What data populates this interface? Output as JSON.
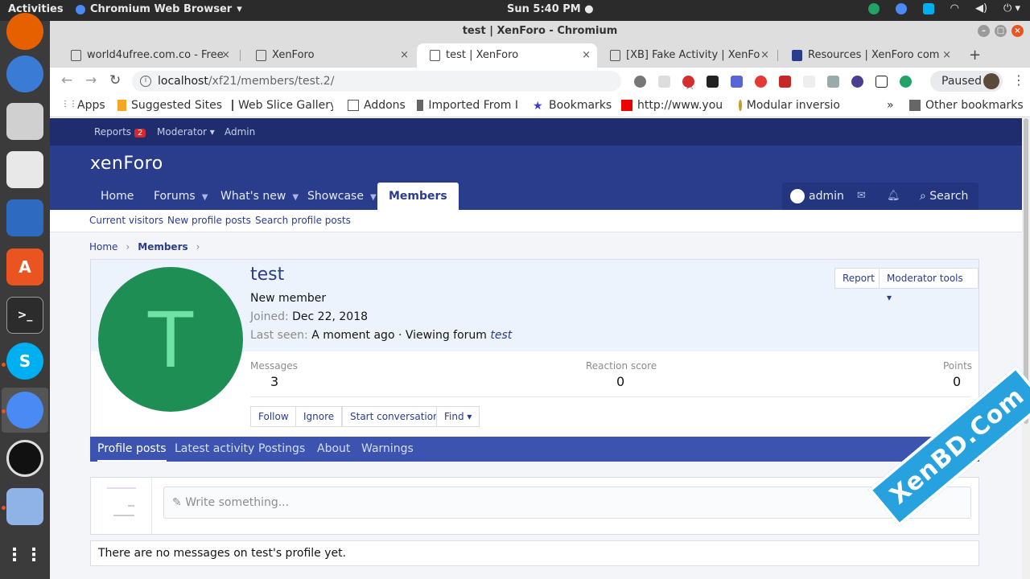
{
  "os": {
    "activities": "Activities",
    "app_name": "Chromium Web Browser",
    "clock": "Sun  5:40 PM ●"
  },
  "window": {
    "title": "test | XenForo - Chromium"
  },
  "tabs": [
    {
      "label": "world4ufree.com.co - Free"
    },
    {
      "label": "XenForo"
    },
    {
      "label": "test | XenForo"
    },
    {
      "label": "[XB] Fake Activity | XenFo"
    },
    {
      "label": "Resources | XenForo com"
    }
  ],
  "toolbar": {
    "url_host": "localhost",
    "url_path": "/xf21/members/test.2/",
    "profile_status": "Paused"
  },
  "bookmarks": [
    {
      "label": "Apps"
    },
    {
      "label": "Suggested Sites"
    },
    {
      "label": "Web Slice Gallery"
    },
    {
      "label": "Addons"
    },
    {
      "label": "Imported From I"
    },
    {
      "label": "Bookmarks"
    },
    {
      "label": "http://www.you"
    },
    {
      "label": "Modular inversio"
    },
    {
      "label": "»"
    },
    {
      "label": "Other bookmarks"
    }
  ],
  "staffbar": {
    "reports": "Reports",
    "reports_count": "2",
    "moderator": "Moderator ▾",
    "admin": "Admin"
  },
  "header": {
    "logo": "xenForo",
    "nav": [
      {
        "label": "Home"
      },
      {
        "label": "Forums"
      },
      {
        "label": "What's new"
      },
      {
        "label": "Showcase"
      },
      {
        "label": "Members"
      }
    ],
    "user": "admin",
    "search": "Search"
  },
  "subnav": [
    {
      "label": "Current visitors"
    },
    {
      "label": "New profile posts"
    },
    {
      "label": "Search profile posts"
    }
  ],
  "breadcrumb": [
    "Home",
    "Members"
  ],
  "profile": {
    "avatar_letter": "T",
    "username": "test",
    "user_title": "New member",
    "joined_label": "Joined:",
    "joined_value": "Dec 22, 2018",
    "seen_label": "Last seen:",
    "seen_value": "A moment ago · Viewing forum",
    "seen_forum": "test",
    "report": "Report",
    "moderator_tools": "Moderator tools ▾",
    "stats": [
      {
        "label": "Messages",
        "value": "3"
      },
      {
        "label": "Reaction score",
        "value": "0"
      },
      {
        "label": "Points",
        "value": "0"
      }
    ],
    "actions": {
      "follow": "Follow",
      "ignore": "Ignore",
      "start_conversation": "Start conversation",
      "find": "Find ▾"
    }
  },
  "profile_tabs": [
    {
      "label": "Profile posts"
    },
    {
      "label": "Latest activity"
    },
    {
      "label": "Postings"
    },
    {
      "label": "About"
    },
    {
      "label": "Warnings"
    }
  ],
  "composer": {
    "placeholder": "Write something..."
  },
  "empty_message": "There are no messages on test's profile yet.",
  "watermark": "XenBD.Com",
  "colors": {
    "staffbar": "#1f2d6e",
    "header": "#2a3c8c",
    "avatar": "#1e8e55",
    "accent_tab": "#3c54b0"
  }
}
